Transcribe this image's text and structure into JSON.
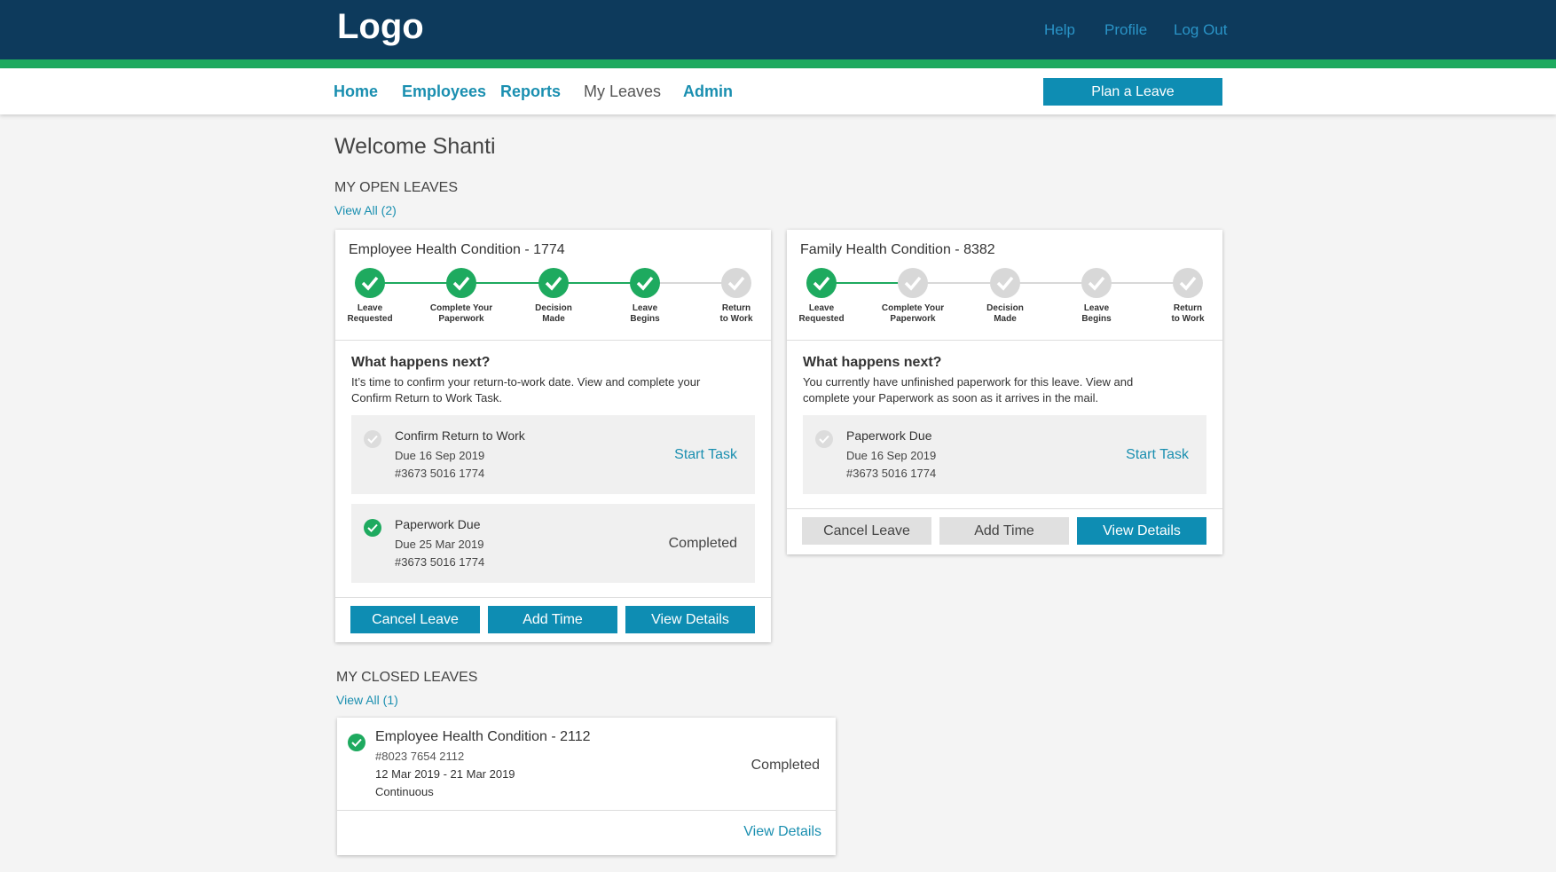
{
  "header": {
    "logo": "Logo",
    "links": {
      "help": "Help",
      "profile": "Profile",
      "logout": "Log Out"
    }
  },
  "nav": {
    "home": "Home",
    "employees": "Employees",
    "reports": "Reports",
    "my_leaves": "My Leaves",
    "admin": "Admin",
    "plan_button": "Plan a Leave"
  },
  "welcome": "Welcome Shanti",
  "open_leaves": {
    "title": "MY OPEN LEAVES",
    "view_all": "View All (2)",
    "cards": [
      {
        "title": "Employee Health Condition - 1774",
        "steps": [
          {
            "label_line1": "Leave",
            "label_line2": "Requested",
            "done": true
          },
          {
            "label_line1": "Complete Your",
            "label_line2": "Paperwork",
            "done": true
          },
          {
            "label_line1": "Decision",
            "label_line2": "Made",
            "done": true
          },
          {
            "label_line1": "Leave",
            "label_line2": "Begins",
            "done": true
          },
          {
            "label_line1": "Return",
            "label_line2": "to Work",
            "done": false
          }
        ],
        "next_title": "What happens next?",
        "next_desc_1": "It’s time to confirm your return-to-work date. View and complete your",
        "next_desc_2": "Confirm Return to Work Task.",
        "tasks": [
          {
            "title": "Confirm Return to Work",
            "due": "Due 16 Sep 2019",
            "number": "#3673 5016 1774",
            "action": "Start Task",
            "status": ""
          },
          {
            "title": "Paperwork Due",
            "due": "Due 25 Mar 2019",
            "number": "#3673 5016 1774",
            "action": "",
            "status": "Completed"
          }
        ],
        "buttons": {
          "cancel": "Cancel Leave",
          "add_time": "Add Time",
          "view_details": "View Details"
        }
      },
      {
        "title": "Family Health Condition - 8382",
        "steps": [
          {
            "label_line1": "Leave",
            "label_line2": "Requested",
            "done": true
          },
          {
            "label_line1": "Complete Your",
            "label_line2": "Paperwork",
            "done": false
          },
          {
            "label_line1": "Decision",
            "label_line2": "Made",
            "done": false
          },
          {
            "label_line1": "Leave",
            "label_line2": "Begins",
            "done": false
          },
          {
            "label_line1": "Return",
            "label_line2": "to Work",
            "done": false
          }
        ],
        "next_title": "What happens next?",
        "next_desc_1": "You currently have unfinished paperwork for this leave. View and",
        "next_desc_2": "complete your Paperwork as soon as it arrives in the mail.",
        "tasks": [
          {
            "title": "Paperwork Due",
            "due": "Due 16 Sep 2019",
            "number": "#3673 5016 1774",
            "action": "Start Task",
            "status": ""
          }
        ],
        "buttons": {
          "cancel": "Cancel Leave",
          "add_time": "Add Time",
          "view_details": "View Details"
        }
      }
    ]
  },
  "closed_leaves": {
    "title": "MY CLOSED LEAVES",
    "view_all": "View All (1)",
    "items": [
      {
        "title": "Employee Health Condition - 2112",
        "number": "#8023 7654 2112",
        "dates": "12 Mar 2019 - 21 Mar 2019",
        "type": "Continuous",
        "status": "Completed",
        "view_details": "View Details"
      }
    ]
  },
  "colors": {
    "header_bg": "#0d3a5c",
    "accent_green": "#1eaa5f",
    "primary_blue": "#0e8db3",
    "link_blue": "#1a8fb0"
  }
}
